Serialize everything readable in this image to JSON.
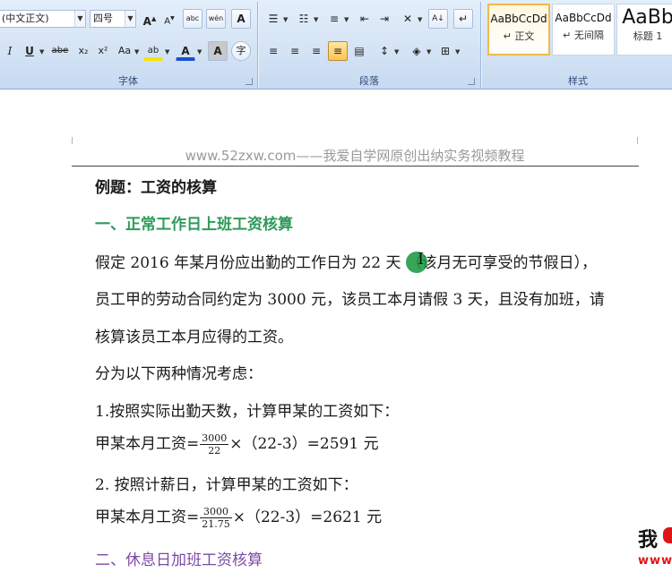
{
  "ribbon": {
    "font_group": {
      "label": "字体",
      "font_name": "(中文正文)",
      "font_size": "四号",
      "grow_label": "A",
      "shrink_label": "A",
      "phonetic_label": "abc",
      "pinyin_label": "wén",
      "border_char_label": "A",
      "italic_label": "I",
      "underline_label": "U",
      "strike_label": "abe",
      "subscript_label": "x₂",
      "superscript_label": "x²",
      "case_label": "Aa",
      "highlight_label": "ab",
      "color_label": "A",
      "shade_label": "A",
      "enclose_label": "字"
    },
    "paragraph_group": {
      "label": "段落",
      "sort_label": "A↓",
      "marks_label": "↵"
    },
    "styles_group": {
      "label": "样式",
      "items": [
        {
          "sample": "AaBbCcDd",
          "name": "↵ 正文"
        },
        {
          "sample": "AaBbCcDd",
          "name": "↵ 无间隔"
        },
        {
          "sample": "AaBb",
          "name": "标题 1"
        }
      ]
    }
  },
  "document": {
    "header": "www.52zxw.com——我爱自学网原创出纳实务视频教程",
    "title": "例题：工资的核算",
    "section1": "一、正常工作日上班工资核算",
    "para1_line1_a": "假定 2016 年某月份应出勤的工作日为 22 天",
    "para1_line1_b": "（该月无可享受的节假日），",
    "para1_line2": "员工甲的劳动合同约定为 3000 元，该员工本月请假 3 天，且没有加班，请",
    "para1_line3": "核算该员工本月应得的工资。",
    "consider": "分为以下两种情况考虑：",
    "case1": "1.按照实际出勤天数，计算甲某的工资如下：",
    "formula1": {
      "prefix": "甲某本月工资=",
      "num": "3000",
      "den": "22",
      "suffix": "×（22-3）=2591 元"
    },
    "case2": "2. 按照计薪日，计算甲某的工资如下：",
    "formula2": {
      "prefix": "甲某本月工资=",
      "num": "3000",
      "den": "21.75",
      "suffix": "×（22-3）=2621 元"
    },
    "section2": "二、休息日加班工资核算"
  },
  "cursor_glyph": "I",
  "logo": {
    "char": "我",
    "sub": "www"
  },
  "colors": {
    "section1": "#2e9a5a",
    "section2": "#7a4aa6",
    "ribbon": "#d5e4f5"
  }
}
